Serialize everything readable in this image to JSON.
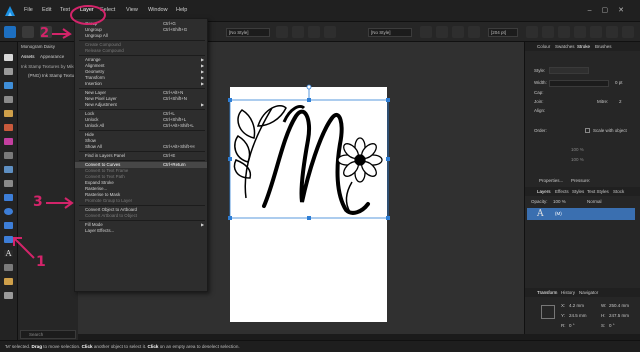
{
  "menubar": {
    "items": [
      "File",
      "Edit",
      "Text",
      "Layer",
      "Select",
      "View",
      "Window",
      "Help"
    ]
  },
  "toolbar": {
    "style_left": "[No Style]",
    "style_right": "[No Style]",
    "size_field": "[204 pt]"
  },
  "layers_panel": {
    "persona": "Monogram Daisy",
    "tabs": [
      "Assets",
      "Appearance"
    ],
    "path": "Ink Stamp Textures by Mike",
    "row": "(PNG) Ink Stamp Textures",
    "search_placeholder": "Search"
  },
  "layer_menu": {
    "items": [
      {
        "label": "Group",
        "shortcut": "Ctrl+G",
        "enabled": true
      },
      {
        "label": "Ungroup",
        "shortcut": "Ctrl+Shift+G",
        "enabled": true
      },
      {
        "label": "Ungroup All",
        "shortcut": "",
        "enabled": true
      },
      {
        "sep": true
      },
      {
        "label": "Create Compound",
        "shortcut": "",
        "enabled": false
      },
      {
        "label": "Release Compound",
        "shortcut": "",
        "enabled": false
      },
      {
        "sep": true
      },
      {
        "label": "Arrange",
        "shortcut": "",
        "enabled": true,
        "submenu": true
      },
      {
        "label": "Alignment",
        "shortcut": "",
        "enabled": true,
        "submenu": true
      },
      {
        "label": "Geometry",
        "shortcut": "",
        "enabled": true,
        "submenu": true
      },
      {
        "label": "Transform",
        "shortcut": "",
        "enabled": true,
        "submenu": true
      },
      {
        "label": "Insertion",
        "shortcut": "",
        "enabled": true,
        "submenu": true
      },
      {
        "sep": true
      },
      {
        "label": "New Layer",
        "shortcut": "Ctrl+Alt+N",
        "enabled": true
      },
      {
        "label": "New Pixel Layer",
        "shortcut": "Ctrl+Shift+N",
        "enabled": true
      },
      {
        "label": "New Adjustment",
        "shortcut": "",
        "enabled": true,
        "submenu": true
      },
      {
        "sep": true
      },
      {
        "label": "Lock",
        "shortcut": "Ctrl+L",
        "enabled": true
      },
      {
        "label": "Unlock",
        "shortcut": "Ctrl+Shift+L",
        "enabled": true
      },
      {
        "label": "Unlock All",
        "shortcut": "Ctrl+Alt+Shift+L",
        "enabled": true
      },
      {
        "sep": true
      },
      {
        "label": "Hide",
        "shortcut": "",
        "enabled": true
      },
      {
        "label": "Show",
        "shortcut": "",
        "enabled": true
      },
      {
        "label": "Show All",
        "shortcut": "Ctrl+Alt+Shift+H",
        "enabled": true
      },
      {
        "sep": true
      },
      {
        "label": "Find in Layers Panel",
        "shortcut": "Ctrl+E",
        "enabled": true
      },
      {
        "sep": true
      },
      {
        "label": "Convert to Curves",
        "shortcut": "Ctrl+Return",
        "enabled": true,
        "highlighted": true
      },
      {
        "label": "Convert to Text Frame",
        "shortcut": "",
        "enabled": false
      },
      {
        "label": "Convert to Text Path",
        "shortcut": "",
        "enabled": false
      },
      {
        "label": "Expand Stroke",
        "shortcut": "",
        "enabled": true
      },
      {
        "label": "Rasterise...",
        "shortcut": "",
        "enabled": true
      },
      {
        "label": "Rasterise to Mask",
        "shortcut": "",
        "enabled": true
      },
      {
        "label": "Promote Group to Layer",
        "shortcut": "",
        "enabled": false
      },
      {
        "sep": true
      },
      {
        "label": "Convert Object to Artboard",
        "shortcut": "",
        "enabled": true
      },
      {
        "label": "Convert Artboard to Object",
        "shortcut": "",
        "enabled": false
      },
      {
        "sep": true
      },
      {
        "label": "Fill Mode",
        "shortcut": "",
        "enabled": true,
        "submenu": true
      },
      {
        "label": "Layer Effects...",
        "shortcut": "",
        "enabled": true
      }
    ]
  },
  "right_panel": {
    "tabs": [
      "Colour",
      "Swatches",
      "Stroke",
      "Brushes"
    ],
    "style_label": "Style:",
    "width_label": "Width:",
    "width_value": "0 pt",
    "cap_label": "Cap:",
    "join_label": "Join:",
    "mitre_label": "Mitre:",
    "mitre_value": "2",
    "align_label": "Align:",
    "order_label": "Order:",
    "scale_label": "Scale with object",
    "pct1": "100 %",
    "pct2": "100 %",
    "properties_label": "Properties...",
    "pressure_label": "Pressure:",
    "layers_tabs": [
      "Layers",
      "Effects",
      "Styles",
      "Text Styles",
      "Stock"
    ],
    "opacity_label": "Opacity:",
    "opacity_value": "100 %",
    "blend_mode": "Normal",
    "layer_name": "(M)",
    "transform_tabs": [
      "Transform",
      "History",
      "Navigator"
    ],
    "x_label": "X:",
    "x_value": "4.2 mm",
    "y_label": "Y:",
    "y_value": "24.5 mm",
    "w_label": "W:",
    "w_value": "250.4 mm",
    "h_label": "H:",
    "h_value": "247.5 mm",
    "r_label": "R:",
    "r_value": "0 °",
    "s_label": "S:",
    "s_value": "0 °"
  },
  "status_bar": {
    "segments": [
      "'M' selected. ",
      "Drag",
      " to move selection. ",
      "Click",
      " another object to select it. ",
      "Click",
      " on an empty area to deselect selection."
    ]
  },
  "annotations": {
    "label_1": "1",
    "label_2": "2",
    "label_3": "3",
    "color": "#d3246a"
  },
  "colors": {
    "accent": "#2f7fd6",
    "menu_highlight": "#474747",
    "canvas": "#303030"
  }
}
